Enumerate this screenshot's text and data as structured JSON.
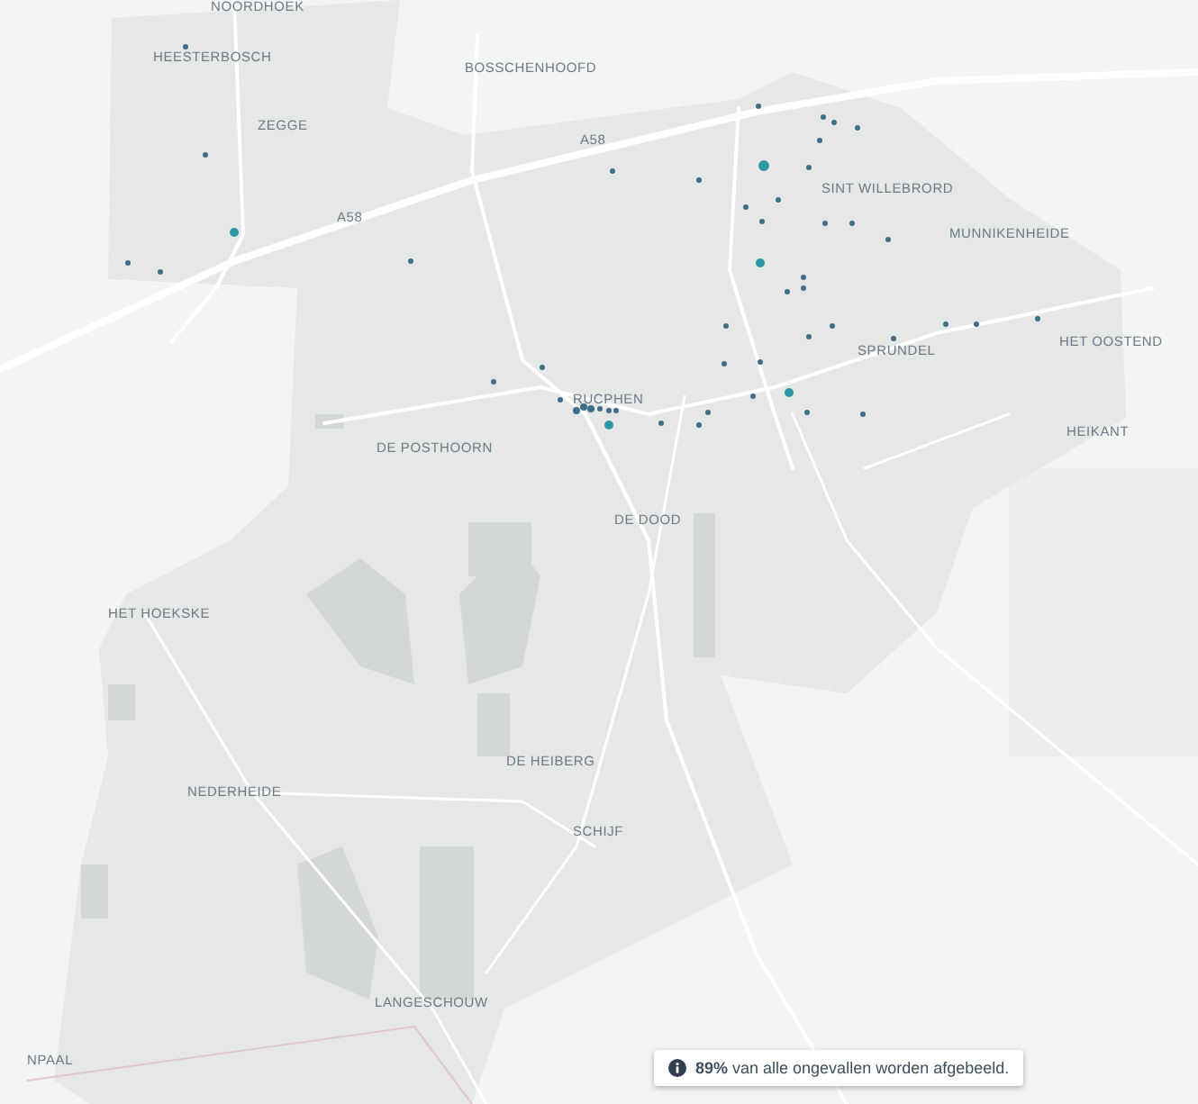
{
  "map": {
    "place_labels": [
      {
        "text": "NOORDHOEK"
      },
      {
        "text": "HEESTERBOSCH"
      },
      {
        "text": "ZEGGE"
      },
      {
        "text": "BOSSCHENHOOFD"
      },
      {
        "text": "A58"
      },
      {
        "text": "A58"
      },
      {
        "text": "SINT WILLEBRORD"
      },
      {
        "text": "MUNNIKENHEIDE"
      },
      {
        "text": "SPRUNDEL"
      },
      {
        "text": "HET OOSTEND"
      },
      {
        "text": "HEIKANT"
      },
      {
        "text": "RUCPHEN"
      },
      {
        "text": "DE POSTHOORN"
      },
      {
        "text": "DE DOOD"
      },
      {
        "text": "HET HOEKSKE"
      },
      {
        "text": "DE HEIBERG"
      },
      {
        "text": "NEDERHEIDE"
      },
      {
        "text": "SCHIJF"
      },
      {
        "text": "LANGESCHOUW"
      },
      {
        "text": "NPAAL"
      }
    ]
  },
  "info_box": {
    "text": "**89%** van alle ongevallen worden afgebeeld."
  }
}
